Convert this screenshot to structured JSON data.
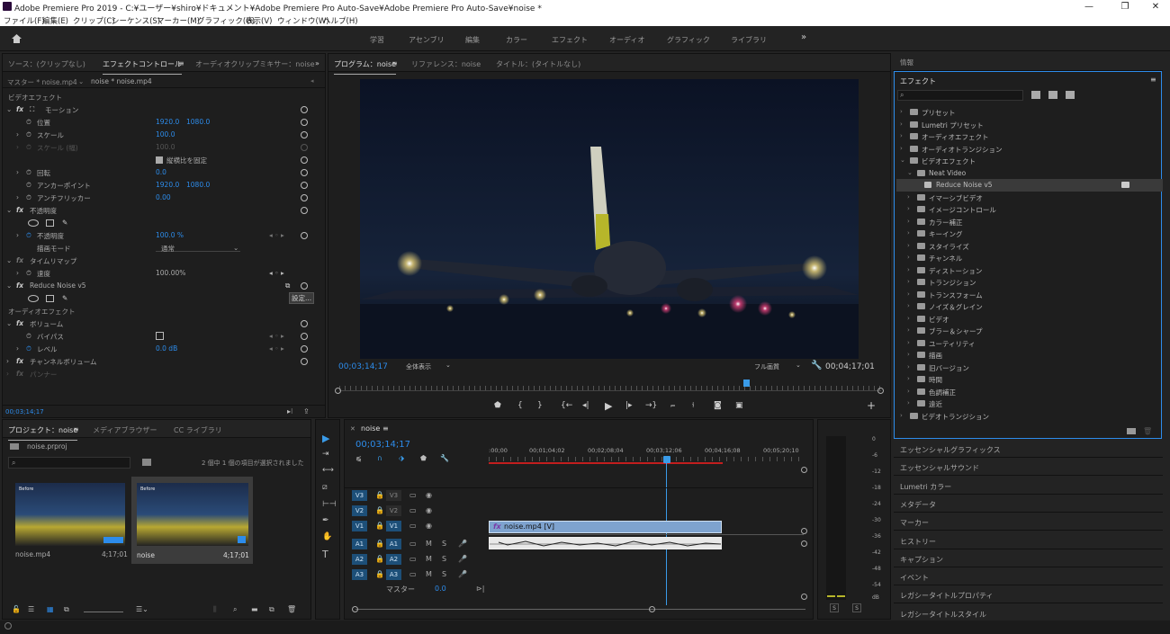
{
  "window": {
    "title": "Adobe Premiere Pro 2019 - C:¥ユーザー¥shiro¥ドキュメント¥Adobe Premiere Pro Auto-Save¥Adobe Premiere Pro Auto-Save¥noise *",
    "min": "—",
    "max": "❐",
    "close": "✕"
  },
  "menu": [
    "ファイル(F)",
    "編集(E)",
    "クリップ(C)",
    "シーケンス(S)",
    "マーカー(M)",
    "グラフィック(G)",
    "表示(V)",
    "ウィンドウ(W)",
    "ヘルプ(H)"
  ],
  "workspaces": [
    "学習",
    "アセンブリ",
    "編集",
    "カラー",
    "エフェクト",
    "オーディオ",
    "グラフィック",
    "ライブラリ"
  ],
  "source_panel": {
    "tabs": [
      "ソース：(クリップなし)",
      "エフェクトコントロール",
      "オーディオクリップミキサー：noise"
    ],
    "master": "マスター * noise.mp4",
    "clip": "noise * noise.mp4",
    "rows": {
      "video_effects": "ビデオエフェクト",
      "motion": "モーション",
      "position": "位置",
      "pos_x": "1920.0",
      "pos_y": "1080.0",
      "scale": "スケール",
      "scale_v": "100.0",
      "scale_w": "スケール (幅)",
      "scale_w_v": "100.0",
      "uniform": "縦横比を固定",
      "rotation": "回転",
      "rotation_v": "0.0",
      "anchor": "アンカーポイント",
      "anc_x": "1920.0",
      "anc_y": "1080.0",
      "flicker": "アンチフリッカー",
      "flicker_v": "0.00",
      "opacity": "不透明度",
      "opacity_p": "不透明度",
      "opacity_v": "100.0 %",
      "blend": "描画モード",
      "blend_v": "通常",
      "timeremap": "タイムリマップ",
      "speed": "速度",
      "speed_v": "100.00%",
      "reduce": "Reduce Noise v5",
      "settings": "設定...",
      "audio_effects": "オーディオエフェクト",
      "volume": "ボリューム",
      "bypass": "バイパス",
      "level": "レベル",
      "level_v": "0.0 dB",
      "channel": "チャンネルボリューム",
      "panner": "パンナー"
    },
    "timecode": "00;03;14;17"
  },
  "program": {
    "tabs": [
      "プログラム：noise",
      "リファレンス：noise",
      "タイトル：(タイトルなし)"
    ],
    "timecode": "00;03;14;17",
    "zoom": "全体表示",
    "quality": "フル画質",
    "duration": "00;04;17;01"
  },
  "project": {
    "tabs": [
      "プロジェクト：noise",
      "メディアブラウザー",
      "CC ライブラリ"
    ],
    "file": "noise.prproj",
    "info": "2 個中 1 個の項目が選択されました",
    "items": [
      {
        "name": "noise.mp4",
        "dur": "4;17;01",
        "thumb": "Before"
      },
      {
        "name": "noise",
        "dur": "4;17;01",
        "thumb": "Before"
      }
    ]
  },
  "timeline": {
    "tab": "noise",
    "timecode": "00;03;14;17",
    "ruler": [
      ":00;00",
      "00;01;04;02",
      "00;02;08;04",
      "00;03;12;06",
      "00;04;16;08",
      "00;05;20;10"
    ],
    "tracks": [
      {
        "id": "V3",
        "src": "V3"
      },
      {
        "id": "V2",
        "src": "V2"
      },
      {
        "id": "V1",
        "src": "V1"
      },
      {
        "id": "A1",
        "src": "A1"
      },
      {
        "id": "A2",
        "src": "A2"
      },
      {
        "id": "A3",
        "src": "A3"
      }
    ],
    "master": "マスター",
    "master_v": "0.0",
    "clip_v": "noise.mp4 [V]",
    "m": "M",
    "s": "S"
  },
  "meter": {
    "labels": [
      "0",
      "-6",
      "-12",
      "-18",
      "-24",
      "-30",
      "-36",
      "-42",
      "-48",
      "-54",
      "dB"
    ],
    "s1": "S",
    "s2": "S"
  },
  "right": {
    "info": "情報",
    "effects": "エフェクト",
    "tree": [
      {
        "d": 0,
        "arr": "›",
        "t": "プリセット"
      },
      {
        "d": 0,
        "arr": "›",
        "t": "Lumetri プリセット"
      },
      {
        "d": 0,
        "arr": "›",
        "t": "オーディオエフェクト"
      },
      {
        "d": 0,
        "arr": "›",
        "t": "オーディオトランジション"
      },
      {
        "d": 0,
        "arr": "⌄",
        "t": "ビデオエフェクト"
      },
      {
        "d": 1,
        "arr": "⌄",
        "t": "Neat Video"
      },
      {
        "d": 2,
        "arr": "",
        "t": "Reduce Noise v5",
        "sel": true
      },
      {
        "d": 1,
        "arr": "›",
        "t": "イマーシブビデオ"
      },
      {
        "d": 1,
        "arr": "›",
        "t": "イメージコントロール"
      },
      {
        "d": 1,
        "arr": "›",
        "t": "カラー補正"
      },
      {
        "d": 1,
        "arr": "›",
        "t": "キーイング"
      },
      {
        "d": 1,
        "arr": "›",
        "t": "スタイライズ"
      },
      {
        "d": 1,
        "arr": "›",
        "t": "チャンネル"
      },
      {
        "d": 1,
        "arr": "›",
        "t": "ディストーション"
      },
      {
        "d": 1,
        "arr": "›",
        "t": "トランジション"
      },
      {
        "d": 1,
        "arr": "›",
        "t": "トランスフォーム"
      },
      {
        "d": 1,
        "arr": "›",
        "t": "ノイズ＆グレイン"
      },
      {
        "d": 1,
        "arr": "›",
        "t": "ビデオ"
      },
      {
        "d": 1,
        "arr": "›",
        "t": "ブラー＆シャープ"
      },
      {
        "d": 1,
        "arr": "›",
        "t": "ユーティリティ"
      },
      {
        "d": 1,
        "arr": "›",
        "t": "描画"
      },
      {
        "d": 1,
        "arr": "›",
        "t": "旧バージョン"
      },
      {
        "d": 1,
        "arr": "›",
        "t": "時間"
      },
      {
        "d": 1,
        "arr": "›",
        "t": "色調補正"
      },
      {
        "d": 1,
        "arr": "›",
        "t": "遠近"
      },
      {
        "d": 0,
        "arr": "›",
        "t": "ビデオトランジション"
      }
    ],
    "panels": [
      "エッセンシャルグラフィックス",
      "エッセンシャルサウンド",
      "Lumetri カラー",
      "メタデータ",
      "マーカー",
      "ヒストリー",
      "キャプション",
      "イベント",
      "レガシータイトルプロパティ",
      "レガシータイトルスタイル"
    ]
  },
  "colors": {
    "accent": "#2d8ceb",
    "playhead": "#3a9be8",
    "clip": "#7ea3cf",
    "inout": "#c21e1e"
  }
}
